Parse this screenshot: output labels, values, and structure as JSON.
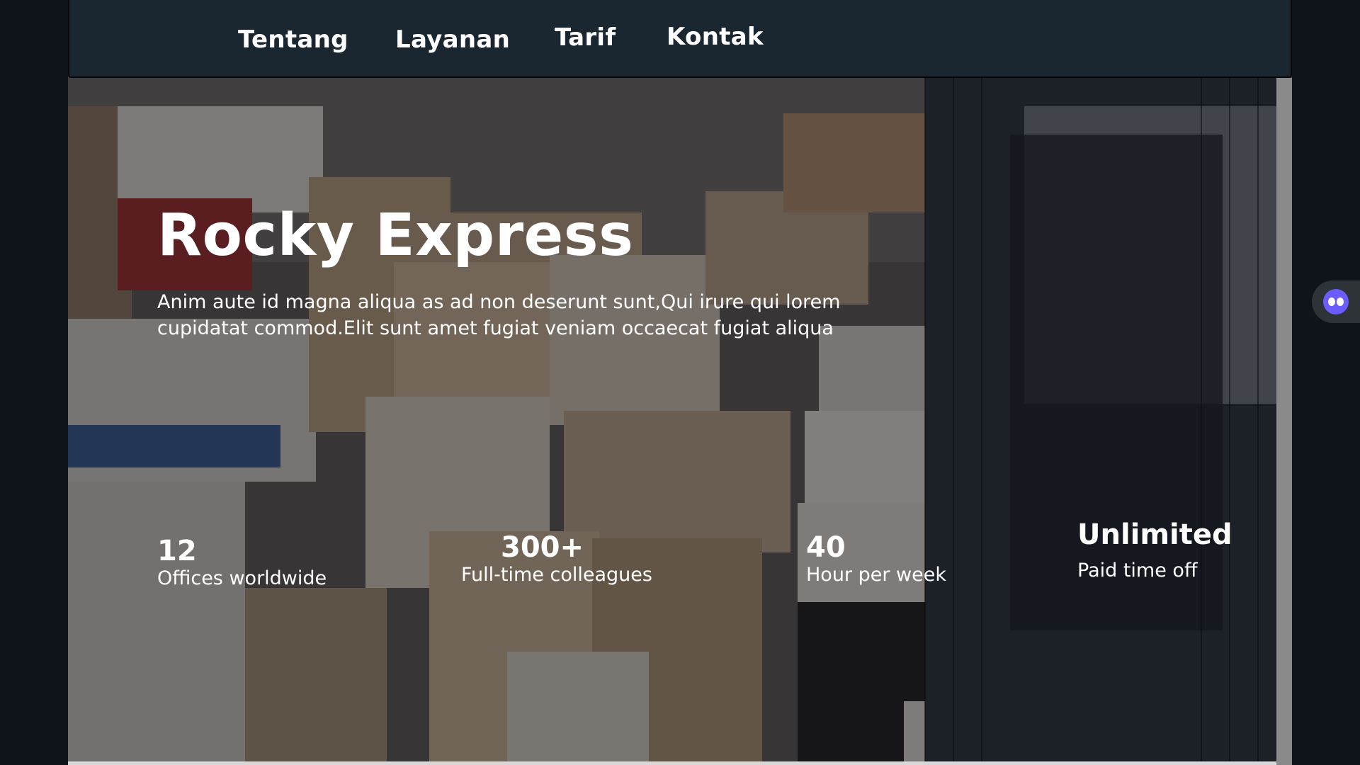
{
  "nav": {
    "items": [
      {
        "label": "Tentang"
      },
      {
        "label": "Layanan"
      },
      {
        "label": "Tarif"
      },
      {
        "label": "Kontak"
      }
    ]
  },
  "hero": {
    "title": "Rocky Express",
    "description": "Anim aute id magna aliqua as ad non deserunt sunt,Qui irure qui lorem cupidatat commod.Elit sunt amet fugiat veniam occaecat fugiat aliqua",
    "background_image": "stacked-cardboard-boxes-photo",
    "stats": [
      {
        "value": "12",
        "label": "Offices worldwide"
      },
      {
        "value": "300+",
        "label": "Full-time colleagues"
      },
      {
        "value": "40",
        "label": "Hour per week"
      },
      {
        "value": "Unlimited",
        "label": "Paid time off"
      }
    ]
  },
  "side_widget": {
    "icon": "assistant-face-icon"
  },
  "colors": {
    "navbar_bg": "#1a2730",
    "page_bg": "#0e1419",
    "text": "#ffffff",
    "widget_accent": "#6a5cff"
  }
}
